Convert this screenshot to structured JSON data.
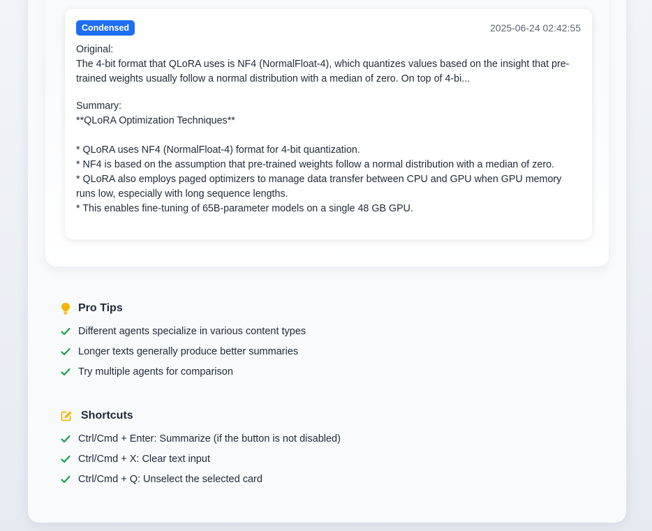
{
  "entry": {
    "badge": "Condensed",
    "timestamp": "2025-06-24 02:42:55",
    "original_label": "Original:",
    "original_text": "The 4-bit format that QLoRA uses is NF4 (NormalFloat-4), which quantizes values based on the insight that pre-trained weights usually follow a normal distribution with a median of zero. On top of 4-bi...",
    "summary_label": "Summary:",
    "summary_text": "**QLoRA Optimization Techniques**\n\n* QLoRA uses NF4 (NormalFloat-4) format for 4-bit quantization.\n* NF4 is based on the assumption that pre-trained weights follow a normal distribution with a median of zero.\n* QLoRA also employs paged optimizers to manage data transfer between CPU and GPU when GPU memory runs low, especially with long sequence lengths.\n* This enables fine-tuning of 65B-parameter models on a single 48 GB GPU."
  },
  "pro_tips": {
    "title": "Pro Tips",
    "icon": "lightbulb-icon",
    "items": [
      "Different agents specialize in various content types",
      "Longer texts generally produce better summaries",
      "Try multiple agents for comparison"
    ]
  },
  "shortcuts": {
    "title": "Shortcuts",
    "icon": "edit-icon",
    "items": [
      "Ctrl/Cmd + Enter: Summarize (if the button is not disabled)",
      "Ctrl/Cmd + X: Clear text input",
      "Ctrl/Cmd + Q: Unselect the selected card"
    ]
  },
  "colors": {
    "badge": "#1d6ef0",
    "check": "#16a34a",
    "icon_accent": "#f5b400"
  }
}
